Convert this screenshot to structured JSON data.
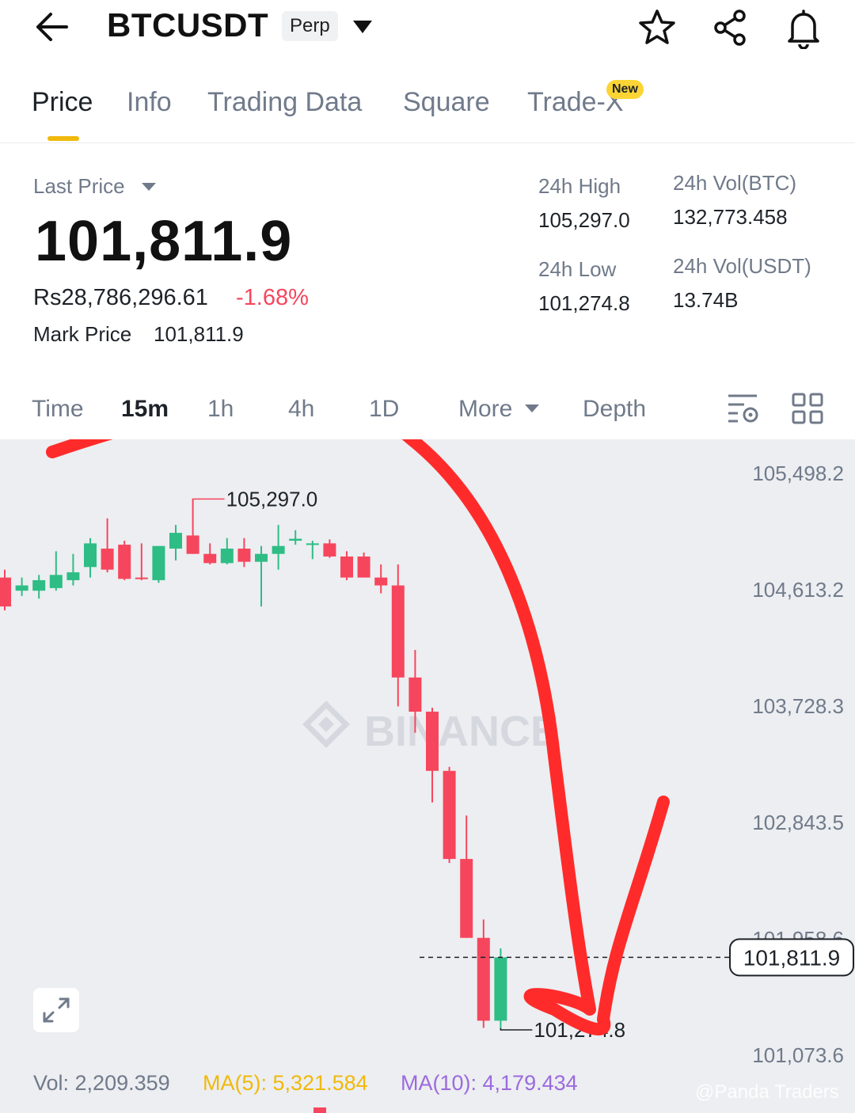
{
  "header": {
    "symbol": "BTCUSDT",
    "contract_type": "Perp",
    "icons": [
      "back-arrow-icon",
      "dropdown-caret-icon",
      "star-icon",
      "share-icon",
      "bell-icon"
    ]
  },
  "tabs": [
    {
      "label": "Price",
      "active": true
    },
    {
      "label": "Info",
      "active": false
    },
    {
      "label": "Trading Data",
      "active": false
    },
    {
      "label": "Square",
      "active": false
    },
    {
      "label": "Trade-X",
      "active": false,
      "badge": "New"
    }
  ],
  "price": {
    "last_price_label": "Last Price",
    "last_price": "101,811.9",
    "fiat_price": "Rs28,786,296.61",
    "change_pct": "-1.68%",
    "mark_price_label": "Mark Price",
    "mark_price": "101,811.9"
  },
  "stats": {
    "high_label": "24h High",
    "high": "105,297.0",
    "low_label": "24h Low",
    "low": "101,274.8",
    "vol_btc_label": "24h Vol(BTC)",
    "vol_btc": "132,773.458",
    "vol_usdt_label": "24h Vol(USDT)",
    "vol_usdt": "13.74B"
  },
  "intervals": {
    "time": "Time",
    "i15": "15m",
    "i1h": "1h",
    "i4h": "4h",
    "i1d": "1D",
    "more": "More",
    "depth": "Depth"
  },
  "chart": {
    "watermark": "BINANCE",
    "high_marker": "105,297.0",
    "low_marker": "101,274.8",
    "current_price_tag": "101,811.9",
    "volume": "Vol: 2,209.359",
    "ma5": "MA(5): 5,321.584",
    "ma10": "MA(10): 4,179.434",
    "credit": "@Panda Traders"
  },
  "colors": {
    "up": "#2ebd85",
    "down": "#f6465d",
    "accent": "#f0b90b",
    "ma5": "#f0b90b",
    "ma10": "#9c6ade",
    "annotation": "#ff2b2b"
  },
  "chart_data": {
    "type": "candlestick",
    "y_ticks": [
      "105,498.2",
      "104,613.2",
      "103,728.3",
      "102,843.5",
      "101,958.6",
      "101,073.6"
    ],
    "ylim": [
      101073.6,
      105498.2
    ],
    "current_price": 101811.9,
    "series": [
      {
        "o": 104700,
        "h": 104760,
        "l": 104450,
        "c": 104480
      },
      {
        "o": 104600,
        "h": 104700,
        "l": 104560,
        "c": 104640
      },
      {
        "o": 104600,
        "h": 104720,
        "l": 104540,
        "c": 104680
      },
      {
        "o": 104620,
        "h": 104900,
        "l": 104600,
        "c": 104720
      },
      {
        "o": 104680,
        "h": 104880,
        "l": 104640,
        "c": 104740
      },
      {
        "o": 104780,
        "h": 105000,
        "l": 104700,
        "c": 104960
      },
      {
        "o": 104920,
        "h": 105150,
        "l": 104740,
        "c": 104760
      },
      {
        "o": 104950,
        "h": 104980,
        "l": 104680,
        "c": 104690
      },
      {
        "o": 104700,
        "h": 104960,
        "l": 104680,
        "c": 104690
      },
      {
        "o": 104680,
        "h": 104900,
        "l": 104660,
        "c": 104940
      },
      {
        "o": 104920,
        "h": 105100,
        "l": 104830,
        "c": 105040
      },
      {
        "o": 105020,
        "h": 105297,
        "l": 104880,
        "c": 104880
      },
      {
        "o": 104880,
        "h": 104960,
        "l": 104800,
        "c": 104810
      },
      {
        "o": 104810,
        "h": 105000,
        "l": 104800,
        "c": 104920
      },
      {
        "o": 104920,
        "h": 105000,
        "l": 104780,
        "c": 104820
      },
      {
        "o": 104820,
        "h": 104940,
        "l": 104480,
        "c": 104880
      },
      {
        "o": 104880,
        "h": 105100,
        "l": 104760,
        "c": 104940
      },
      {
        "o": 104980,
        "h": 105060,
        "l": 104950,
        "c": 104995
      },
      {
        "o": 104960,
        "h": 104980,
        "l": 104840,
        "c": 104960
      },
      {
        "o": 104960,
        "h": 104990,
        "l": 104850,
        "c": 104860
      },
      {
        "o": 104860,
        "h": 104900,
        "l": 104680,
        "c": 104700
      },
      {
        "o": 104860,
        "h": 104890,
        "l": 104700,
        "c": 104700
      },
      {
        "o": 104700,
        "h": 104800,
        "l": 104580,
        "c": 104640
      },
      {
        "o": 104640,
        "h": 104800,
        "l": 103720,
        "c": 103940
      },
      {
        "o": 103940,
        "h": 104150,
        "l": 103520,
        "c": 103680
      },
      {
        "o": 103680,
        "h": 103710,
        "l": 102990,
        "c": 103230
      },
      {
        "o": 103230,
        "h": 103260,
        "l": 102530,
        "c": 102560
      },
      {
        "o": 102560,
        "h": 102890,
        "l": 101960,
        "c": 101960
      },
      {
        "o": 101960,
        "h": 102100,
        "l": 101275,
        "c": 101330
      },
      {
        "o": 101330,
        "h": 101880,
        "l": 101260,
        "c": 101812
      }
    ]
  }
}
